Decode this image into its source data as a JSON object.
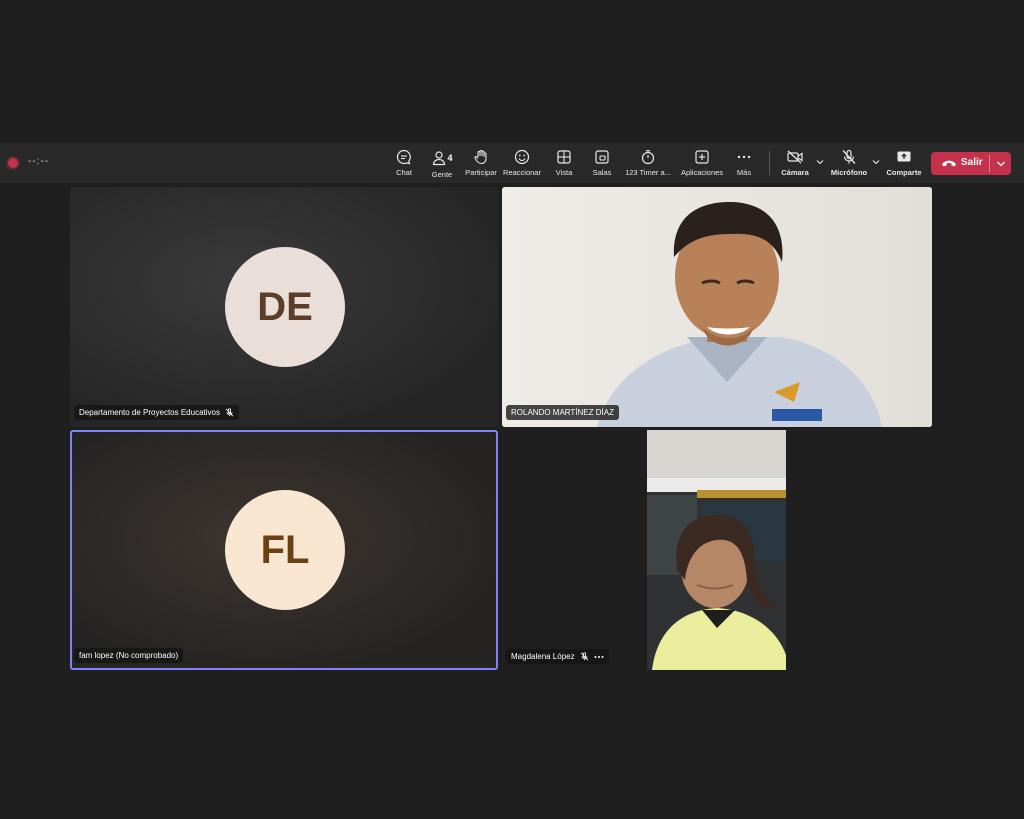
{
  "meeting": {
    "recording_time": "--:--",
    "toolbar": {
      "chat": "Chat",
      "people": "Gente",
      "people_count": "4",
      "raise": "Participar",
      "react": "Reaccionar",
      "view": "Vista",
      "rooms": "Salas",
      "timer": "123 Timer a...",
      "apps": "Aplicaciones",
      "more": "Más",
      "camera": "Cámara",
      "mic": "Micrófono",
      "share": "Comparte",
      "leave": "Salir"
    }
  },
  "participants": [
    {
      "initials": "DE",
      "name": "Departamento de Proyectos Educativos",
      "muted": true
    },
    {
      "name": "ROLANDO MARTÍNEZ DÍAZ",
      "muted": false
    },
    {
      "initials": "FL",
      "name": "fam lopez (No comprobado)",
      "muted": false,
      "speaking": true
    },
    {
      "name": "Magdalena López",
      "muted": true
    }
  ],
  "colors": {
    "background": "#1f1f1f",
    "toolbar": "#292929",
    "leave_button": "#c4314b",
    "speaking_border": "#7f85f5",
    "avatar_de_bg": "#eadfd8",
    "avatar_de_text": "#5c3d2a",
    "avatar_fl_bg": "#f9e6d1",
    "avatar_fl_text": "#6b4216"
  }
}
